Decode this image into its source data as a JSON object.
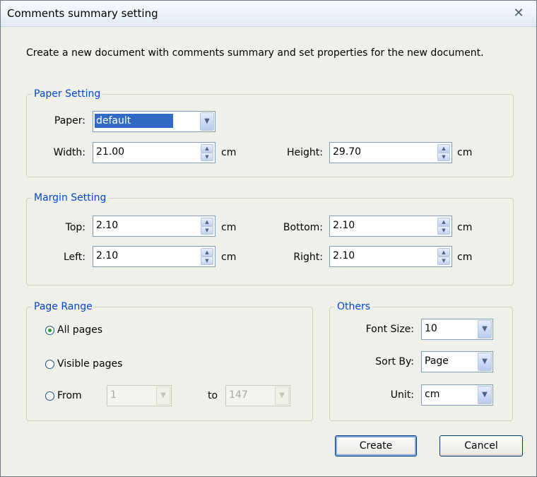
{
  "dialog": {
    "title": "Comments summary setting",
    "close_glyph": "✕",
    "description": "Create a new document with comments summary and set properties for the new document."
  },
  "paper_setting": {
    "legend": "Paper Setting",
    "paper_label": "Paper:",
    "paper_value": "default",
    "width_label": "Width:",
    "width_value": "21.00",
    "width_unit": "cm",
    "height_label": "Height:",
    "height_value": "29.70",
    "height_unit": "cm"
  },
  "margin_setting": {
    "legend": "Margin Setting",
    "top_label": "Top:",
    "top_value": "2.10",
    "top_unit": "cm",
    "bottom_label": "Bottom:",
    "bottom_value": "2.10",
    "bottom_unit": "cm",
    "left_label": "Left:",
    "left_value": "2.10",
    "left_unit": "cm",
    "right_label": "Right:",
    "right_value": "2.10",
    "right_unit": "cm"
  },
  "page_range": {
    "legend": "Page Range",
    "all_pages": "All pages",
    "visible_pages": "Visible pages",
    "from_label": "From",
    "from_value": "1",
    "to_label": "to",
    "to_value": "147",
    "selected": "all_pages"
  },
  "others": {
    "legend": "Others",
    "font_size_label": "Font Size:",
    "font_size_value": "10",
    "sort_by_label": "Sort By:",
    "sort_by_value": "Page",
    "unit_label": "Unit:",
    "unit_value": "cm"
  },
  "buttons": {
    "create": "Create",
    "cancel": "Cancel"
  },
  "icons": {
    "spin_up": "▲",
    "spin_down": "▼",
    "dropdown": "▼"
  },
  "colors": {
    "legend_text": "#0046d5",
    "selection": "#316ac5",
    "radio_dot": "#21a121"
  }
}
